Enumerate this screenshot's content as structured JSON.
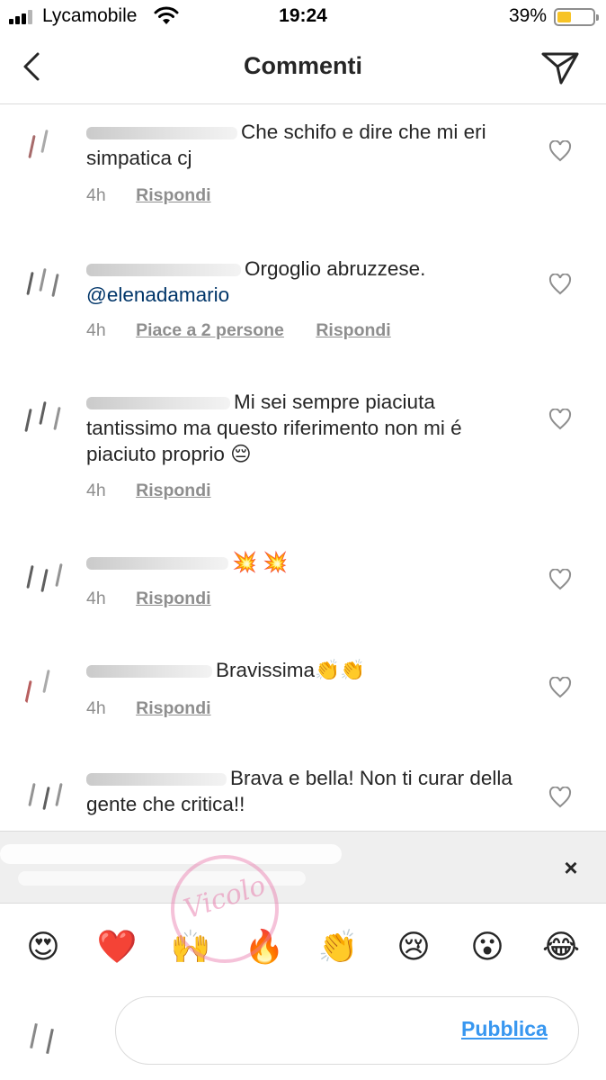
{
  "status_bar": {
    "carrier": "Lycamobile",
    "time": "19:24",
    "battery_percent": "39%",
    "battery_level": 0.39,
    "signal_icon": "signal-bars-icon",
    "wifi_icon": "wifi-icon",
    "battery_icon": "battery-icon"
  },
  "header": {
    "title": "Commenti",
    "back_icon": "chevron-left-icon",
    "send_icon": "paper-plane-icon"
  },
  "comments": [
    {
      "text": "Che schifo e dire che mi eri simpatica cj",
      "time": "4h",
      "reply_label": "Rispondi"
    },
    {
      "text": "Orgoglio abruzzese.",
      "mention": "@elenadamario",
      "time": "4h",
      "likes_label": "Piace a 2 persone",
      "reply_label": "Rispondi"
    },
    {
      "text": "Mi sei sempre piaciuta tantissimo ma questo riferimento non mi é piaciuto proprio 😔",
      "time": "4h",
      "reply_label": "Rispondi"
    },
    {
      "text": "💥 💥",
      "time": "4h",
      "reply_label": "Rispondi"
    },
    {
      "text": "Bravissima👏👏",
      "time": "4h",
      "reply_label": "Rispondi"
    },
    {
      "text": "Brava e bella! Non ti curar della gente che critica!!"
    }
  ],
  "notice": {
    "close_label": "×"
  },
  "emoji_bar": [
    "😍",
    "❤️",
    "🙌",
    "🔥",
    "👏",
    "😢",
    "😮",
    "😂"
  ],
  "composer": {
    "publish_label": "Pubblica"
  },
  "colors": {
    "accent_blue": "#3897f0",
    "mention_blue": "#003569",
    "meta_gray": "#8e8e8e",
    "battery_yellow": "#f7c325",
    "watermark_pink": "#e878aa"
  }
}
